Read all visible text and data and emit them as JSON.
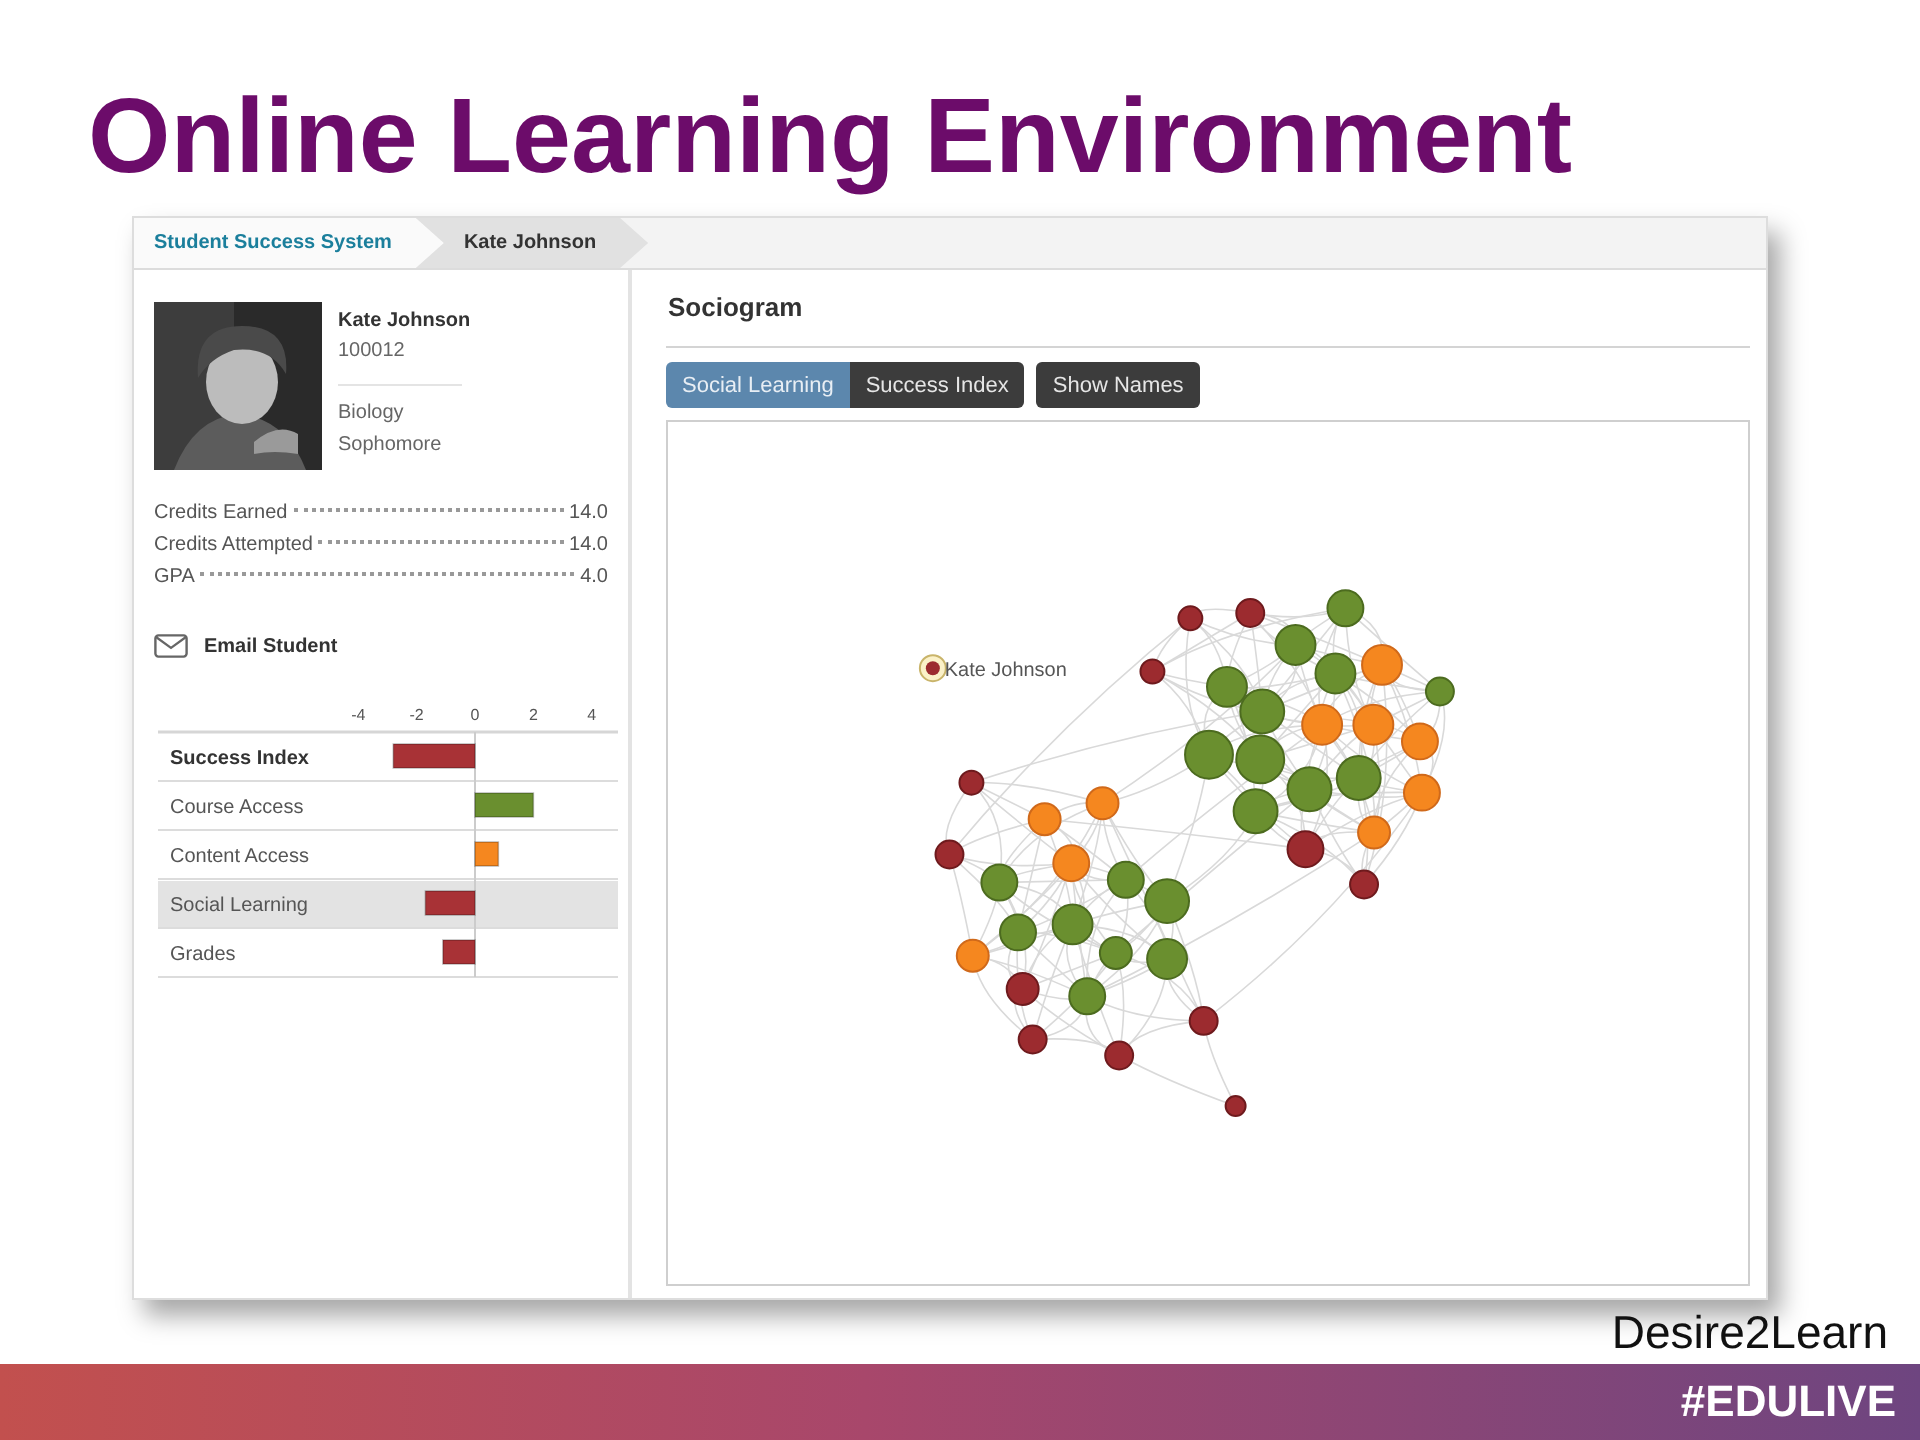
{
  "slide_title": "Online Learning Environment",
  "breadcrumbs": [
    {
      "label": "Student Success System",
      "selected": false
    },
    {
      "label": "Kate Johnson",
      "selected": true
    }
  ],
  "student": {
    "name": "Kate Johnson",
    "id": "100012",
    "program": "Biology",
    "year": "Sophomore"
  },
  "stats": [
    {
      "label": "Credits Earned",
      "value": "14.0"
    },
    {
      "label": "Credits Attempted",
      "value": "14.0"
    },
    {
      "label": "GPA",
      "value": "4.0"
    }
  ],
  "email_action": "Email Student",
  "index_rows": [
    {
      "kind": "total",
      "selected": false
    },
    {
      "kind": "part",
      "selected": false
    },
    {
      "kind": "part",
      "selected": false
    },
    {
      "kind": "part",
      "selected": true
    },
    {
      "kind": "part",
      "selected": false
    }
  ],
  "index_chart": {
    "chart_data": {
      "type": "bar",
      "orientation": "horizontal",
      "categories": [
        "Success Index",
        "Course Access",
        "Content Access",
        "Social Learning",
        "Grades"
      ],
      "series": [
        {
          "color": "#a83236",
          "values": [
            -2.8,
            null,
            null,
            -1.7,
            -1.1
          ]
        },
        {
          "color": "#6a8f2f",
          "values": [
            null,
            2.0,
            null,
            null,
            null
          ]
        },
        {
          "color": "#f5871f",
          "values": [
            null,
            null,
            0.8,
            null,
            null
          ]
        }
      ],
      "xlim": [
        -11,
        4.9
      ],
      "xticks": [
        -4,
        -2,
        0,
        2,
        4
      ]
    }
  },
  "sociogram": {
    "title": "Sociogram",
    "view_buttons": [
      {
        "label": "Social Learning",
        "selected": true
      },
      {
        "label": "Success Index",
        "selected": false
      }
    ],
    "show_names_button": "Show Names",
    "highlighted_student": "Kate Johnson"
  },
  "credit": "Desire2Learn",
  "hashtag": "#EDULIVE"
}
